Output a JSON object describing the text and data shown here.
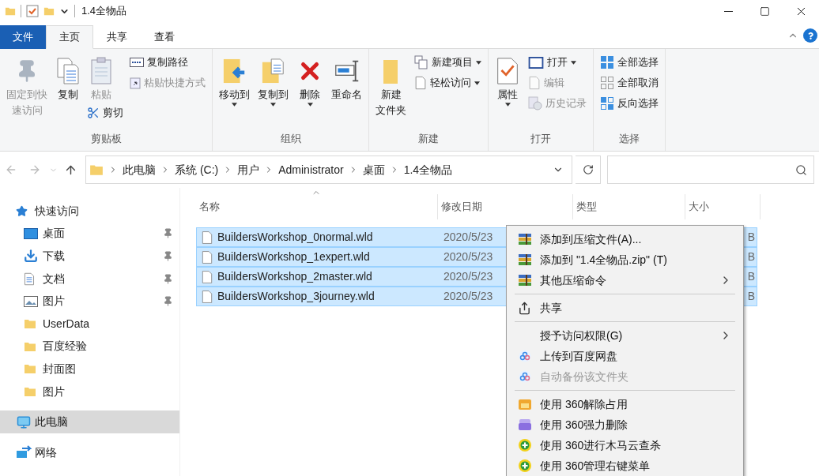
{
  "window": {
    "title": "1.4全物品"
  },
  "ribbon_tabs": [
    {
      "label": "文件",
      "kind": "file",
      "selected": false
    },
    {
      "label": "主页",
      "kind": "tab",
      "selected": true
    },
    {
      "label": "共享",
      "kind": "tab",
      "selected": false
    },
    {
      "label": "查看",
      "kind": "tab",
      "selected": false
    }
  ],
  "ribbon_groups": [
    {
      "label": "剪贴板",
      "buttons": [
        {
          "kind": "large",
          "lines": [
            "固定到快",
            "速访问"
          ],
          "disabled": true,
          "dropdown": false
        },
        {
          "kind": "large",
          "lines": [
            "复制"
          ],
          "disabled": false,
          "dropdown": false
        },
        {
          "kind": "large",
          "lines": [
            "粘贴"
          ],
          "disabled": true,
          "dropdown": false
        },
        {
          "kind": "under",
          "label": "剪切",
          "disabled": false,
          "dropdown": false
        },
        {
          "kind": "small",
          "label": "复制路径",
          "disabled": false,
          "dropdown": false
        },
        {
          "kind": "small",
          "label": "粘贴快捷方式",
          "disabled": true,
          "dropdown": false
        }
      ]
    },
    {
      "label": "组织",
      "buttons": [
        {
          "kind": "large",
          "lines": [
            "移动到"
          ],
          "disabled": false,
          "dropdown": true
        },
        {
          "kind": "large",
          "lines": [
            "复制到"
          ],
          "disabled": false,
          "dropdown": true
        },
        {
          "kind": "large",
          "lines": [
            "删除"
          ],
          "disabled": false,
          "dropdown": true
        },
        {
          "kind": "large",
          "lines": [
            "重命名"
          ],
          "disabled": false,
          "dropdown": false
        }
      ]
    },
    {
      "label": "新建",
      "buttons": [
        {
          "kind": "large",
          "lines": [
            "新建",
            "文件夹"
          ],
          "disabled": false,
          "dropdown": false
        },
        {
          "kind": "small",
          "label": "新建项目",
          "disabled": false,
          "dropdown": true
        },
        {
          "kind": "small",
          "label": "轻松访问",
          "disabled": false,
          "dropdown": true
        }
      ]
    },
    {
      "label": "打开",
      "buttons": [
        {
          "kind": "large",
          "lines": [
            "属性"
          ],
          "disabled": false,
          "dropdown": true
        },
        {
          "kind": "small",
          "label": "打开",
          "disabled": false,
          "dropdown": true
        },
        {
          "kind": "small",
          "label": "编辑",
          "disabled": true,
          "dropdown": false
        },
        {
          "kind": "small",
          "label": "历史记录",
          "disabled": true,
          "dropdown": false
        }
      ]
    },
    {
      "label": "选择",
      "buttons": [
        {
          "kind": "small",
          "label": "全部选择",
          "disabled": false,
          "dropdown": false
        },
        {
          "kind": "small",
          "label": "全部取消",
          "disabled": false,
          "dropdown": false
        },
        {
          "kind": "small",
          "label": "反向选择",
          "disabled": false,
          "dropdown": false
        }
      ]
    }
  ],
  "address_bar": {
    "path": [
      "此电脑",
      "系统 (C:)",
      "用户",
      "Administrator",
      "桌面",
      "1.4全物品"
    ]
  },
  "sidebar": {
    "items": [
      {
        "label": "快速访问",
        "kind": "quick",
        "selected": false,
        "pinned": false,
        "children": [
          {
            "label": "桌面",
            "kind": "desktop",
            "selected": false,
            "pinned": true
          },
          {
            "label": "下载",
            "kind": "download",
            "selected": false,
            "pinned": true
          },
          {
            "label": "文档",
            "kind": "document",
            "selected": false,
            "pinned": true
          },
          {
            "label": "图片",
            "kind": "pictures",
            "selected": false,
            "pinned": true
          },
          {
            "label": "UserData",
            "kind": "folder",
            "selected": false,
            "pinned": false
          },
          {
            "label": "百度经验",
            "kind": "folder",
            "selected": false,
            "pinned": false
          },
          {
            "label": "封面图",
            "kind": "folder",
            "selected": false,
            "pinned": false
          },
          {
            "label": "图片",
            "kind": "folder",
            "selected": false,
            "pinned": false
          }
        ]
      },
      {
        "label": "此电脑",
        "kind": "pc",
        "selected": true,
        "pinned": false
      },
      {
        "label": "网络",
        "kind": "network",
        "selected": false,
        "pinned": false
      }
    ]
  },
  "file_list": {
    "columns": [
      "名称",
      "修改日期",
      "类型",
      "大小"
    ],
    "rows": [
      {
        "name": "BuildersWorkshop_0normal.wld",
        "date": "2020/5/23",
        "size": "B",
        "selected": true
      },
      {
        "name": "BuildersWorkshop_1expert.wld",
        "date": "2020/5/23",
        "size": "B",
        "selected": true
      },
      {
        "name": "BuildersWorkshop_2master.wld",
        "date": "2020/5/23",
        "size": "B",
        "selected": true
      },
      {
        "name": "BuildersWorkshop_3journey.wld",
        "date": "2020/5/23",
        "size": "B",
        "selected": true
      }
    ]
  },
  "context_menu": {
    "sections": [
      [
        {
          "label": "添加到压缩文件(A)...",
          "disabled": false,
          "submenu": false
        },
        {
          "label": "添加到 \"1.4全物品.zip\" (T)",
          "disabled": false,
          "submenu": false
        },
        {
          "label": "其他压缩命令",
          "disabled": false,
          "submenu": true
        }
      ],
      [
        {
          "label": "共享",
          "disabled": false,
          "submenu": false
        }
      ],
      [
        {
          "label": "授予访问权限(G)",
          "disabled": false,
          "submenu": true
        },
        {
          "label": "上传到百度网盘",
          "disabled": false,
          "submenu": false
        },
        {
          "label": "自动备份该文件夹",
          "disabled": true,
          "submenu": false
        }
      ],
      [
        {
          "label": "使用 360解除占用",
          "disabled": false,
          "submenu": false
        },
        {
          "label": "使用 360强力删除",
          "disabled": false,
          "submenu": false
        },
        {
          "label": "使用 360进行木马云查杀",
          "disabled": false,
          "submenu": false
        },
        {
          "label": "使用 360管理右键菜单",
          "disabled": false,
          "submenu": false
        }
      ]
    ]
  }
}
